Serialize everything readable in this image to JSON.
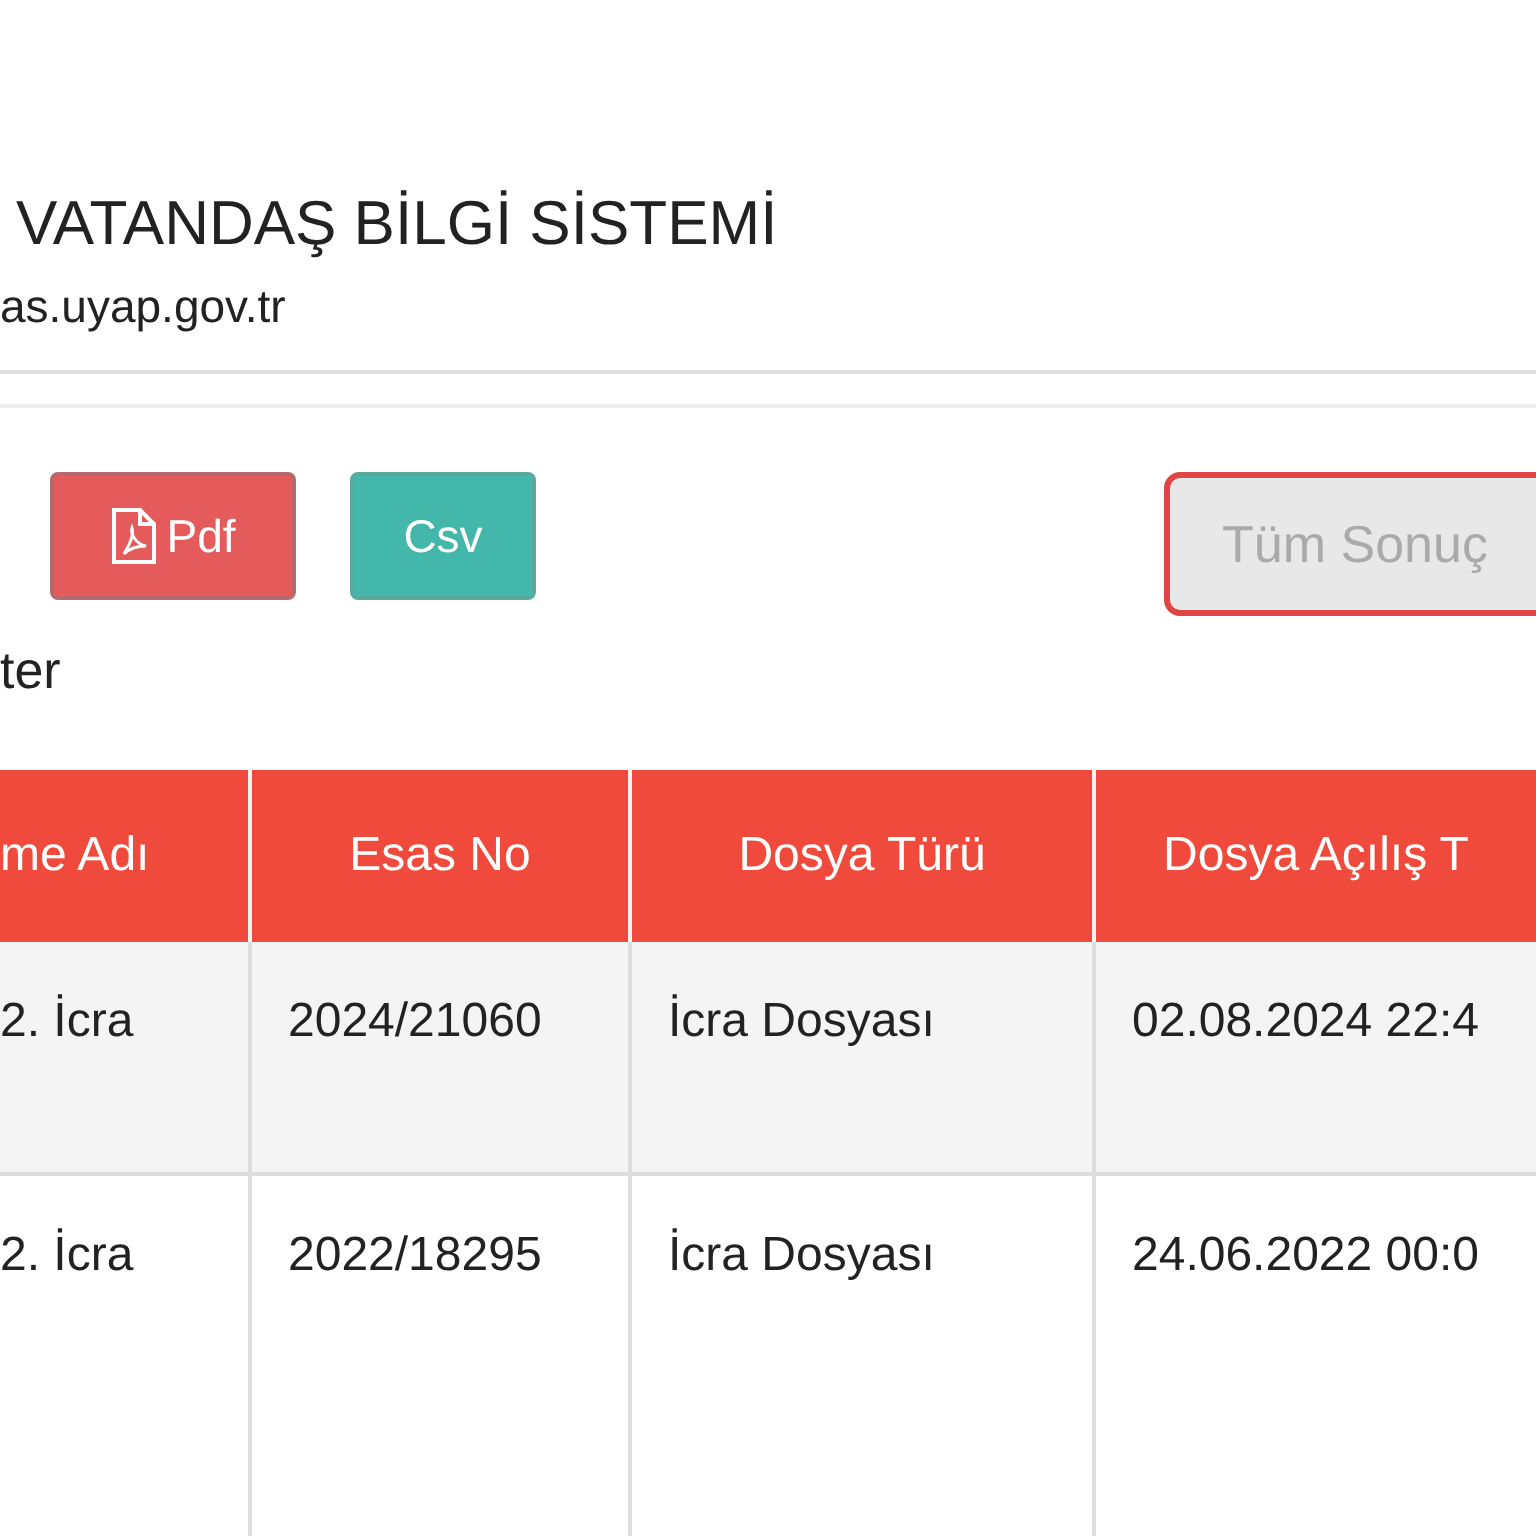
{
  "header": {
    "title": "VATANDAŞ BİLGİ SİSTEMİ",
    "subtitle": "as.uyap.gov.tr"
  },
  "export_buttons": [
    {
      "label": "Pdf",
      "kind": "pdf"
    },
    {
      "label": "Csv",
      "kind": "csv"
    }
  ],
  "search": {
    "placeholder": "Tüm Sonuç"
  },
  "filter_label": "ter",
  "table": {
    "columns": [
      "me Adı",
      "Esas No",
      "Dosya Türü",
      "Dosya Açılış T"
    ],
    "rows": [
      [
        "2. İcra",
        "2024/21060",
        "İcra Dosyası",
        "02.08.2024 22:4"
      ],
      [
        "2. İcra",
        "2022/18295",
        "İcra Dosyası",
        "24.06.2022 00:0"
      ]
    ]
  }
}
